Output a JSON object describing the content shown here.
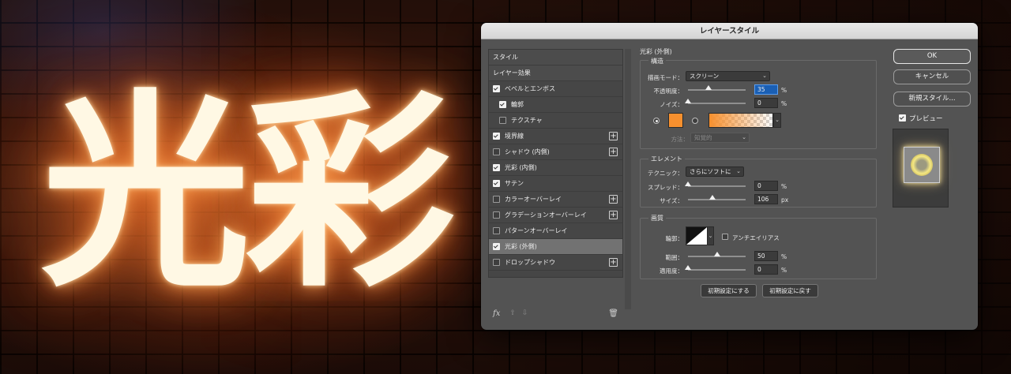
{
  "artwork": {
    "neon_text": "光彩"
  },
  "dialog": {
    "title": "レイヤースタイル",
    "styles_list": [
      {
        "label": "スタイル",
        "checkbox": null,
        "indent": false,
        "plus": false,
        "selected": false
      },
      {
        "label": "レイヤー効果",
        "checkbox": null,
        "indent": false,
        "plus": false,
        "selected": false
      },
      {
        "label": "ベベルとエンボス",
        "checkbox": true,
        "indent": false,
        "plus": false,
        "selected": false
      },
      {
        "label": "輪郭",
        "checkbox": true,
        "indent": true,
        "plus": false,
        "selected": false
      },
      {
        "label": "テクスチャ",
        "checkbox": false,
        "indent": true,
        "plus": false,
        "selected": false
      },
      {
        "label": "境界線",
        "checkbox": true,
        "indent": false,
        "plus": true,
        "selected": false
      },
      {
        "label": "シャドウ (内側)",
        "checkbox": false,
        "indent": false,
        "plus": true,
        "selected": false
      },
      {
        "label": "光彩 (内側)",
        "checkbox": true,
        "indent": false,
        "plus": false,
        "selected": false
      },
      {
        "label": "サテン",
        "checkbox": true,
        "indent": false,
        "plus": false,
        "selected": false
      },
      {
        "label": "カラーオーバーレイ",
        "checkbox": false,
        "indent": false,
        "plus": true,
        "selected": false
      },
      {
        "label": "グラデーションオーバーレイ",
        "checkbox": false,
        "indent": false,
        "plus": true,
        "selected": false
      },
      {
        "label": "パターンオーバーレイ",
        "checkbox": false,
        "indent": false,
        "plus": false,
        "selected": false
      },
      {
        "label": "光彩 (外側)",
        "checkbox": true,
        "indent": false,
        "plus": false,
        "selected": true
      },
      {
        "label": "ドロップシャドウ",
        "checkbox": false,
        "indent": false,
        "plus": true,
        "selected": false
      }
    ],
    "footer": {
      "fx": "fx",
      "up": "⇧",
      "down": "⇩",
      "trash": "🗑"
    },
    "panel": {
      "title": "光彩 (外側)",
      "structure": {
        "title": "構造",
        "blend_mode_label": "描画モード：",
        "blend_mode_value": "スクリーン",
        "opacity_label": "不透明度：",
        "opacity_value": "35",
        "opacity_level": 35,
        "noise_label": "ノイズ：",
        "noise_value": "0",
        "noise_level": 0,
        "percent": "%",
        "method_label": "方法：",
        "method_value": "知覚的",
        "glow_color": "#f7902e"
      },
      "elements": {
        "title": "エレメント",
        "technique_label": "テクニック：",
        "technique_value": "さらにソフトに",
        "spread_label": "スプレッド：",
        "spread_value": "0",
        "spread_level": 0,
        "size_label": "サイズ：",
        "size_value": "106",
        "size_level": 42,
        "percent": "%",
        "px": "px"
      },
      "quality": {
        "title": "画質",
        "contour_label": "輪郭：",
        "antialias_label": "アンチエイリアス",
        "range_label": "範囲：",
        "range_value": "50",
        "range_level": 50,
        "jitter_label": "適用度：",
        "jitter_value": "0",
        "jitter_level": 0,
        "percent": "%"
      },
      "buttons": {
        "make_default": "初期設定にする",
        "reset_default": "初期設定に戻す"
      }
    },
    "actions": {
      "ok": "OK",
      "cancel": "キャンセル",
      "new_style": "新規スタイル...",
      "preview_label": "プレビュー",
      "preview_checked": true
    }
  }
}
